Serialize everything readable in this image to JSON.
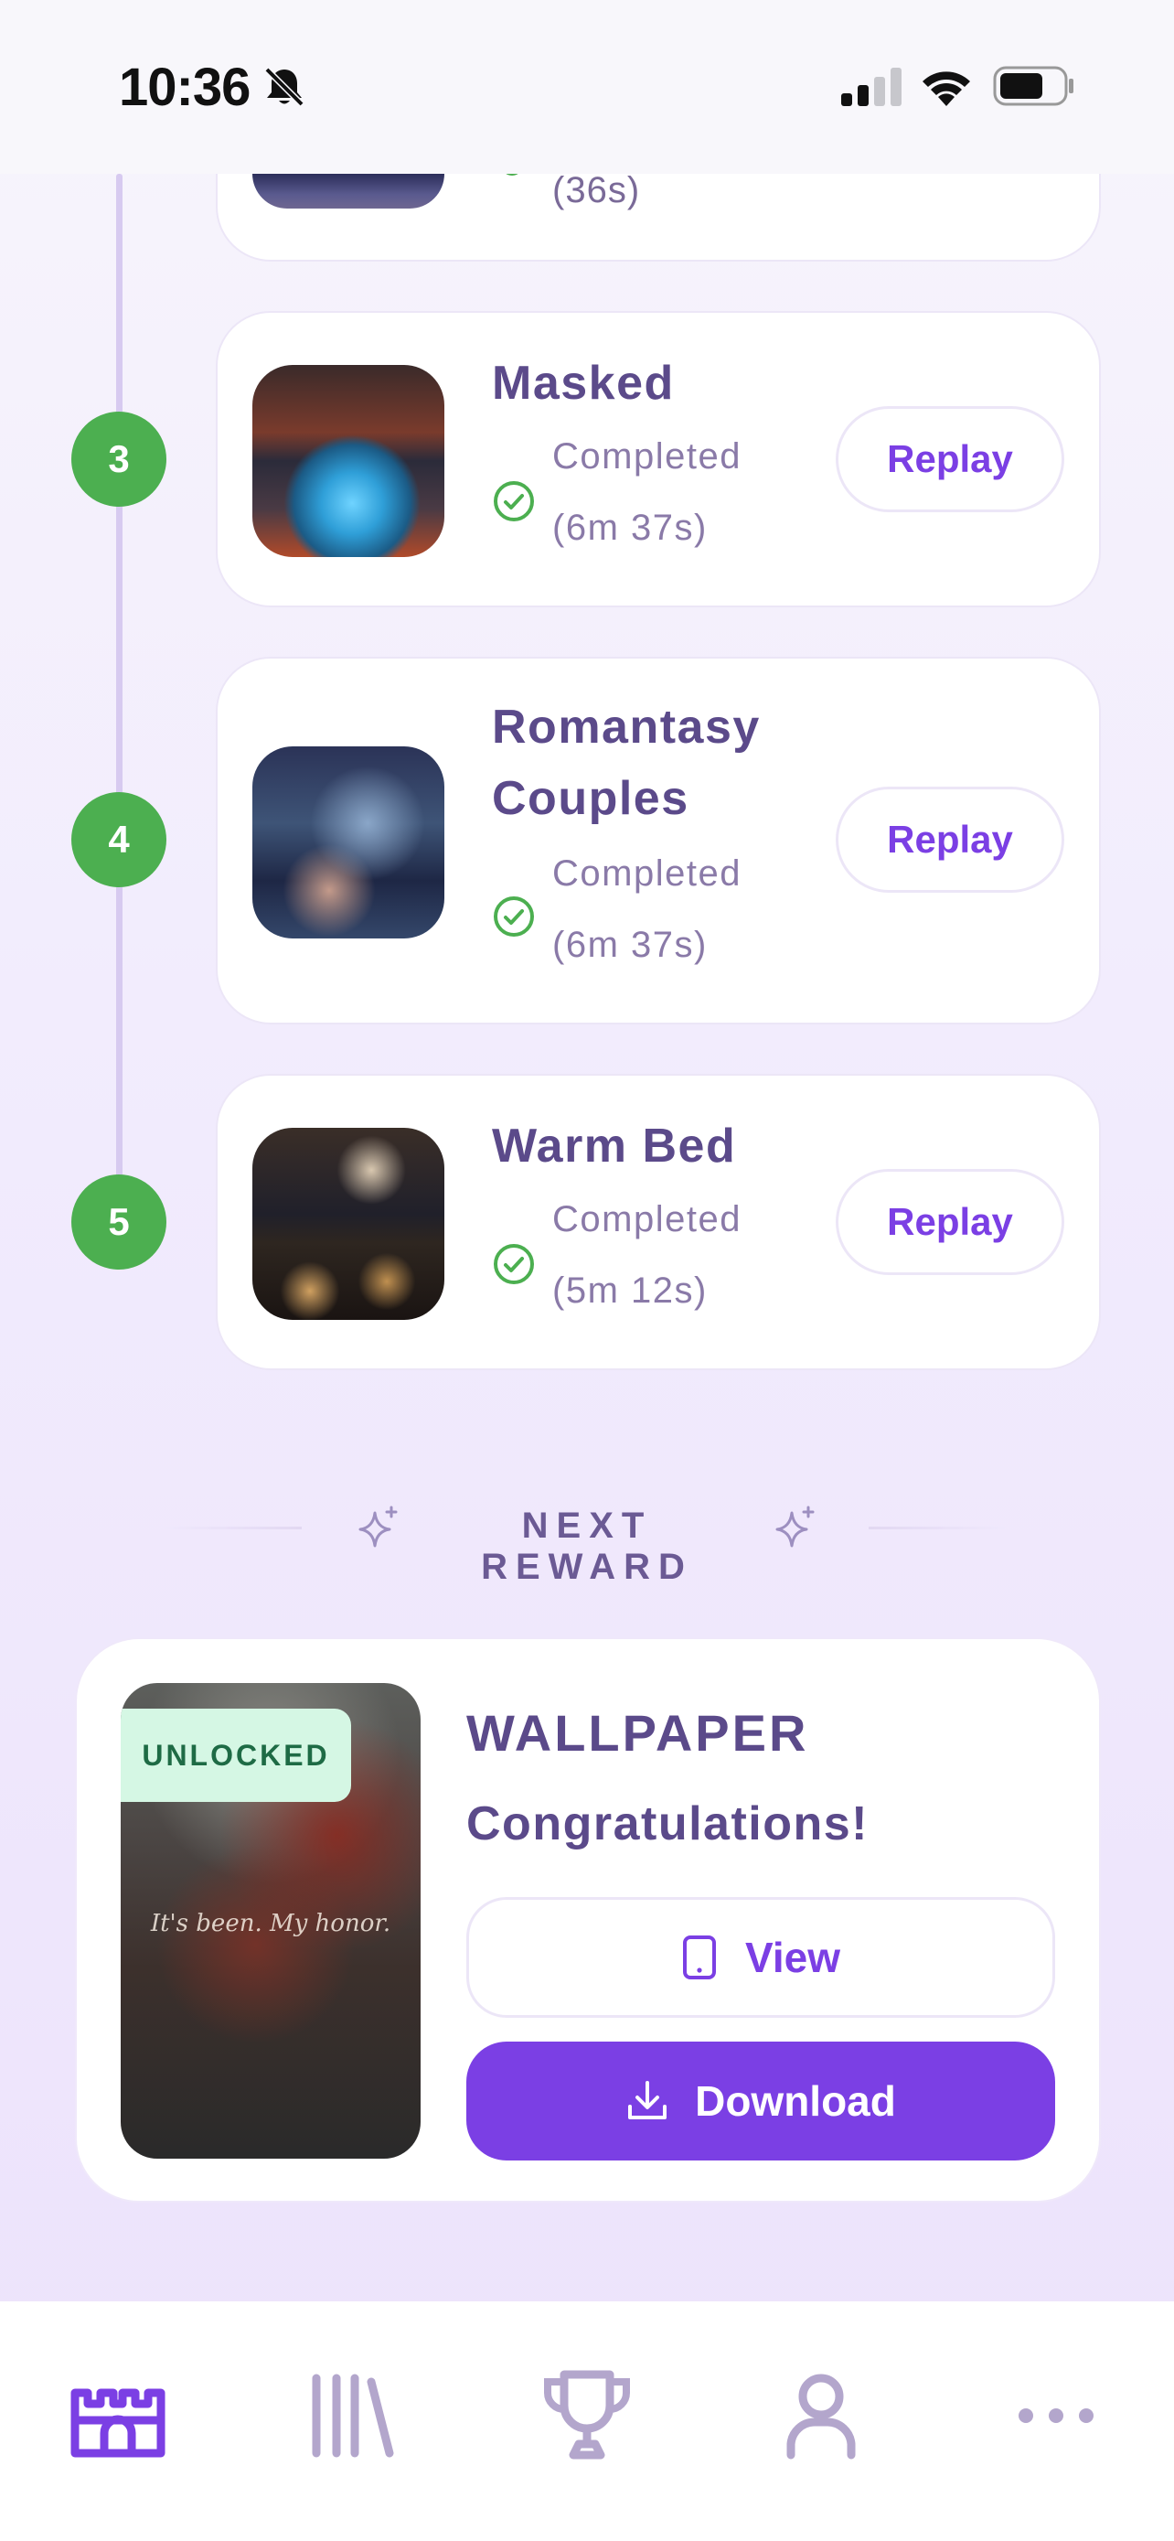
{
  "status_bar": {
    "time": "10:36"
  },
  "levels_partial": {
    "duration": "(36s)"
  },
  "levels": [
    {
      "number": "3",
      "title": "Masked",
      "status": "Completed",
      "duration": "(6m 37s)",
      "action": "Replay"
    },
    {
      "number": "4",
      "title": "Romantasy Couples",
      "status": "Completed",
      "duration": "(6m 37s)",
      "action": "Replay"
    },
    {
      "number": "5",
      "title": "Warm Bed",
      "status": "Completed",
      "duration": "(5m 12s)",
      "action": "Replay"
    }
  ],
  "reward": {
    "section_label": "NEXT REWARD",
    "badge": "UNLOCKED",
    "image_caption": "It's been. My honor.",
    "type": "WALLPAPER",
    "message": "Congratulations!",
    "view_label": "View",
    "download_label": "Download"
  },
  "tab_bar": {
    "items": [
      {
        "icon": "castle-icon",
        "active": true
      },
      {
        "icon": "library-icon",
        "active": false
      },
      {
        "icon": "trophy-icon",
        "active": false
      },
      {
        "icon": "profile-icon",
        "active": false
      },
      {
        "icon": "more-icon",
        "active": false
      }
    ]
  },
  "colors": {
    "accent": "#7b3fe4",
    "success": "#4caf50",
    "title_text": "#5b4a8a",
    "muted_text": "#8a7aa8",
    "inactive_icon": "#b3a6cc"
  }
}
